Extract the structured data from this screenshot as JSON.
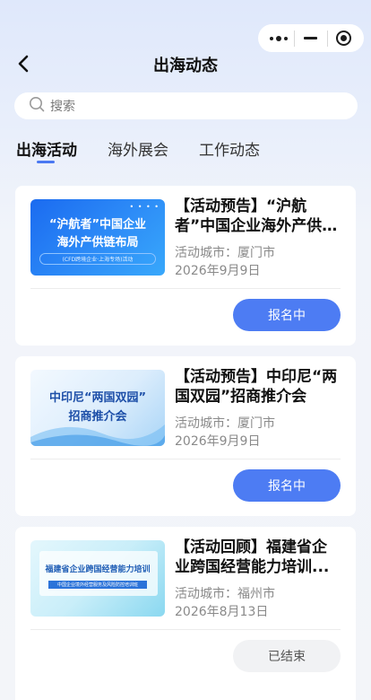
{
  "nav": {
    "title": "出海动态"
  },
  "search": {
    "placeholder": "搜索"
  },
  "tabs": [
    {
      "label": "出海活动",
      "active": true
    },
    {
      "label": "海外展会",
      "active": false
    },
    {
      "label": "工作动态",
      "active": false
    }
  ],
  "cards": [
    {
      "title": "【活动预告】“沪航者”中国企业海外产供链...",
      "city": "活动城市：厦门市",
      "date": "2026年9月9日",
      "button": "报名中",
      "thumb": {
        "line1": "“沪航者”中国企业",
        "line2": "海外产供链布局",
        "line3": "(CFD跨境企业·上海专场)活动"
      }
    },
    {
      "title": "【活动预告】中印尼“两国双园”招商推介会",
      "city": "活动城市：厦门市",
      "date": "2026年9月9日",
      "button": "报名中",
      "thumb": {
        "line1": "中印尼“两国双园”",
        "line2": "招商推介会"
      }
    },
    {
      "title": "【活动回顾】福建省企业跨国经营能力培训...",
      "city": "活动城市：福州市",
      "date": "2026年8月13日",
      "button": "已结束",
      "thumb": {
        "line1": "福建省企业跨国经营能力培训",
        "line2": "中国企业境外经营服务及风险防控培训班"
      }
    }
  ],
  "colors": {
    "accent": "#4a78f2",
    "button_active": "#4d7cf3",
    "button_ended": "#f1f2f4"
  }
}
